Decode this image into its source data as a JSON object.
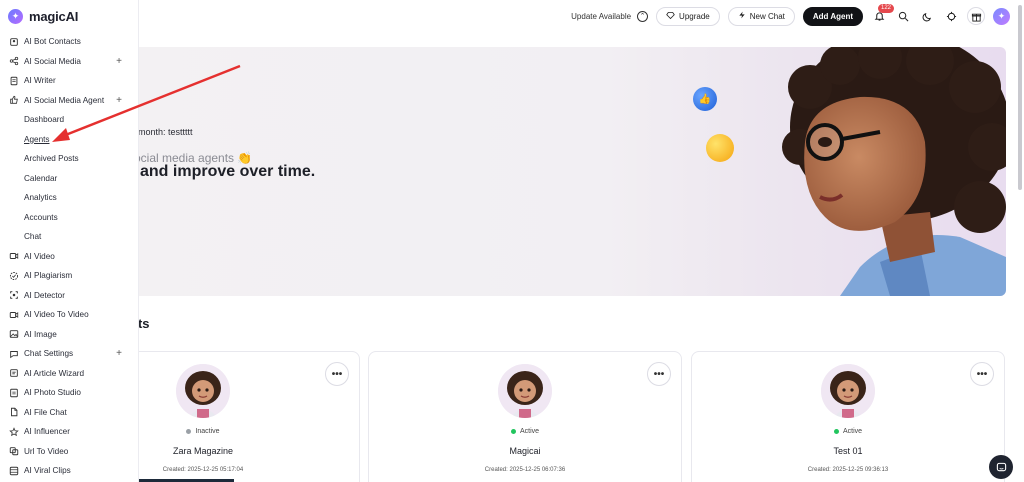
{
  "brand": {
    "name": "magicAI"
  },
  "sidebar": {
    "items": [
      {
        "label": "AI Bot Contacts",
        "icon": "contacts-icon",
        "plus": ""
      },
      {
        "label": "AI Social Media",
        "icon": "share-icon",
        "plus": "+"
      },
      {
        "label": "AI Writer",
        "icon": "document-icon",
        "plus": ""
      },
      {
        "label": "AI Social Media Agent",
        "icon": "thumbs-up-icon",
        "plus": "+"
      },
      {
        "label": "Dashboard",
        "sub": true
      },
      {
        "label": "Agents",
        "sub": true,
        "active": true
      },
      {
        "label": "Archived Posts",
        "sub": true
      },
      {
        "label": "Calendar",
        "sub": true
      },
      {
        "label": "Analytics",
        "sub": true
      },
      {
        "label": "Accounts",
        "sub": true
      },
      {
        "label": "Chat",
        "sub": true
      },
      {
        "label": "AI Video",
        "icon": "video-icon",
        "plus": ""
      },
      {
        "label": "AI Plagiarism",
        "icon": "plagiarism-icon",
        "plus": ""
      },
      {
        "label": "AI Detector",
        "icon": "detector-icon",
        "plus": ""
      },
      {
        "label": "AI Video To Video",
        "icon": "video-icon",
        "plus": ""
      },
      {
        "label": "AI Image",
        "icon": "image-icon",
        "plus": ""
      },
      {
        "label": "Chat Settings",
        "icon": "chat-icon",
        "plus": "+"
      },
      {
        "label": "AI Article Wizard",
        "icon": "wizard-icon",
        "plus": ""
      },
      {
        "label": "AI Photo Studio",
        "icon": "photo-icon",
        "plus": ""
      },
      {
        "label": "AI File Chat",
        "icon": "file-icon",
        "plus": ""
      },
      {
        "label": "AI Influencer",
        "icon": "star-icon",
        "plus": ""
      },
      {
        "label": "Url To Video",
        "icon": "link-icon",
        "plus": ""
      },
      {
        "label": "AI Viral Clips",
        "icon": "clips-icon",
        "plus": ""
      }
    ]
  },
  "header": {
    "update_label": "Update Available",
    "upgrade_label": "Upgrade",
    "new_chat_label": "New Chat",
    "add_agent_label": "Add Agent",
    "notification_count": "122"
  },
  "hero": {
    "month_text": "month: testtttt",
    "subtitle": "ocial media agents 👏",
    "title": "and improve over time."
  },
  "section": {
    "title": "nts"
  },
  "agents": [
    {
      "name": "Zara Magazine",
      "status": "Inactive",
      "status_color": "#9aa0a6",
      "created": "Created: 2025-12-25 05:17:04"
    },
    {
      "name": "Magicai",
      "status": "Active",
      "status_color": "#22c55e",
      "created": "Created: 2025-12-25 06:07:36"
    },
    {
      "name": "Test 01",
      "status": "Active",
      "status_color": "#22c55e",
      "created": "Created: 2025-12-25 09:36:13"
    }
  ],
  "colors": {
    "accent": "#e5302f",
    "dark": "#111216"
  }
}
